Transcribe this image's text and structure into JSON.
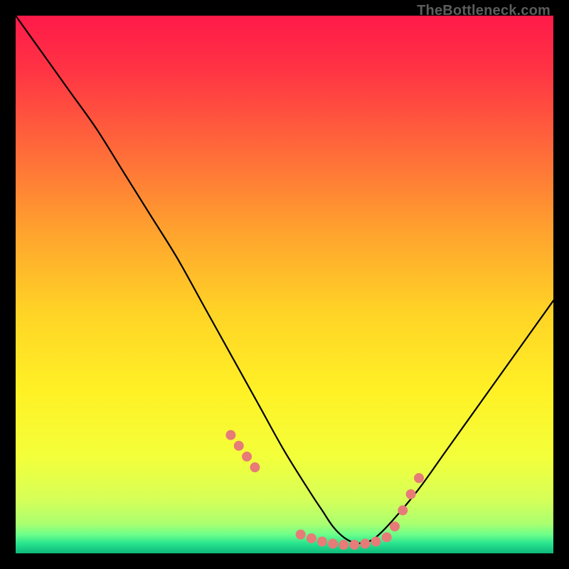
{
  "watermark": "TheBottleneck.com",
  "chart_data": {
    "type": "line",
    "title": "",
    "xlabel": "",
    "ylabel": "",
    "xlim": [
      0,
      100
    ],
    "ylim": [
      0,
      100
    ],
    "grid": false,
    "legend": false,
    "series": [
      {
        "name": "curve",
        "x": [
          0,
          5,
          10,
          15,
          20,
          25,
          30,
          35,
          40,
          45,
          50,
          55,
          57,
          59,
          61,
          63,
          65,
          67,
          70,
          75,
          80,
          85,
          90,
          95,
          100
        ],
        "values": [
          100,
          93,
          86,
          79,
          71,
          63,
          55,
          46,
          37,
          28,
          19,
          11,
          8,
          5,
          3,
          2,
          2,
          3,
          6,
          12,
          19,
          26,
          33,
          40,
          47
        ]
      }
    ],
    "markers": {
      "name": "highlight-dots",
      "color": "#e77b77",
      "points_x": [
        40,
        41.5,
        43,
        44.5,
        53,
        55,
        57,
        59,
        61,
        63,
        65,
        67,
        69,
        70.5,
        72,
        73.5,
        75
      ],
      "points_y": [
        22,
        20,
        18,
        16,
        3.5,
        2.8,
        2.2,
        1.8,
        1.6,
        1.6,
        1.8,
        2.2,
        3.0,
        5,
        8,
        11,
        14
      ]
    },
    "gradient_stops": [
      {
        "offset": 0.0,
        "color": "#ff1a49"
      },
      {
        "offset": 0.1,
        "color": "#ff3344"
      },
      {
        "offset": 0.25,
        "color": "#ff6a3a"
      },
      {
        "offset": 0.4,
        "color": "#ffa22e"
      },
      {
        "offset": 0.55,
        "color": "#ffd326"
      },
      {
        "offset": 0.7,
        "color": "#fff126"
      },
      {
        "offset": 0.82,
        "color": "#f3ff3a"
      },
      {
        "offset": 0.9,
        "color": "#d6ff58"
      },
      {
        "offset": 0.945,
        "color": "#aaff70"
      },
      {
        "offset": 0.965,
        "color": "#6dff8a"
      },
      {
        "offset": 0.982,
        "color": "#27e38f"
      },
      {
        "offset": 1.0,
        "color": "#0fb87a"
      }
    ]
  }
}
